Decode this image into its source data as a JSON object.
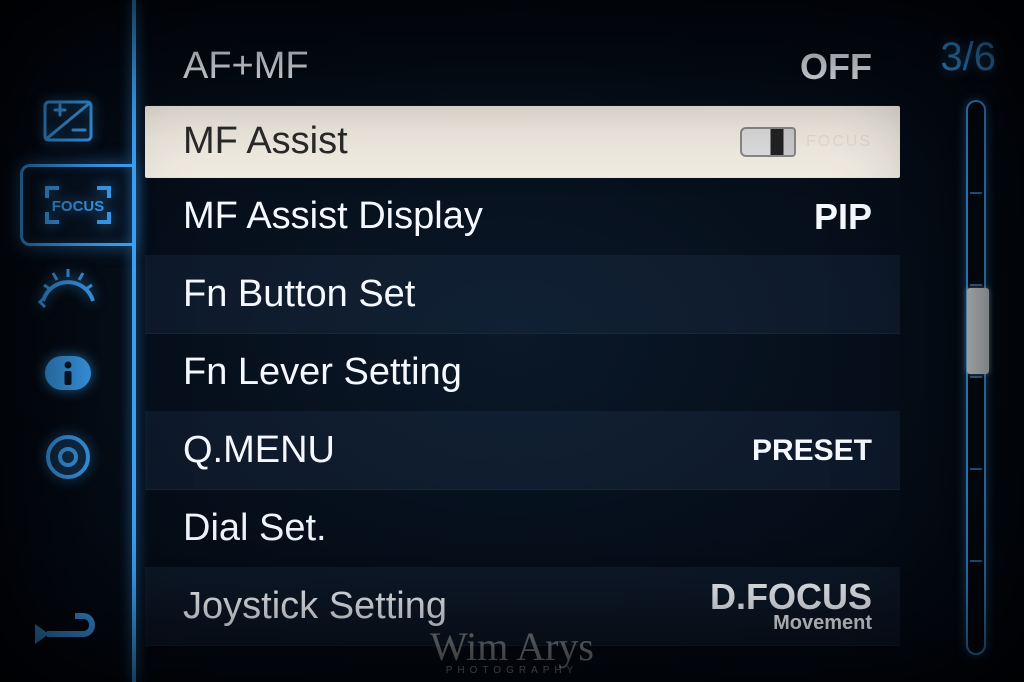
{
  "page": {
    "current": 3,
    "total": 6,
    "display": "3/6"
  },
  "sidebar": {
    "selected_index": 1,
    "tabs": [
      {
        "name": "exposure-comp"
      },
      {
        "name": "focus"
      },
      {
        "name": "dial"
      },
      {
        "name": "info"
      },
      {
        "name": "monitor"
      }
    ]
  },
  "menu": {
    "items": [
      {
        "label": "AF+MF",
        "value": "OFF",
        "selected": false
      },
      {
        "label": "MF Assist",
        "value_icon": "lens",
        "value_text": "FOCUS",
        "selected": true
      },
      {
        "label": "MF Assist Display",
        "value": "PIP",
        "selected": false
      },
      {
        "label": "Fn Button Set",
        "value": "",
        "selected": false
      },
      {
        "label": "Fn Lever Setting",
        "value": "",
        "selected": false
      },
      {
        "label": "Q.MENU",
        "value": "PRESET",
        "selected": false
      },
      {
        "label": "Dial Set.",
        "value": "",
        "selected": false
      },
      {
        "label": "Joystick Setting",
        "value_main": "D.FOCUS",
        "value_sub": "Movement",
        "selected": false
      }
    ]
  },
  "scrollbar": {
    "segments": 6,
    "thumb_segment": 2
  },
  "watermark": {
    "name": "Wim Arys",
    "sub": "PHOTOGRAPHY"
  }
}
